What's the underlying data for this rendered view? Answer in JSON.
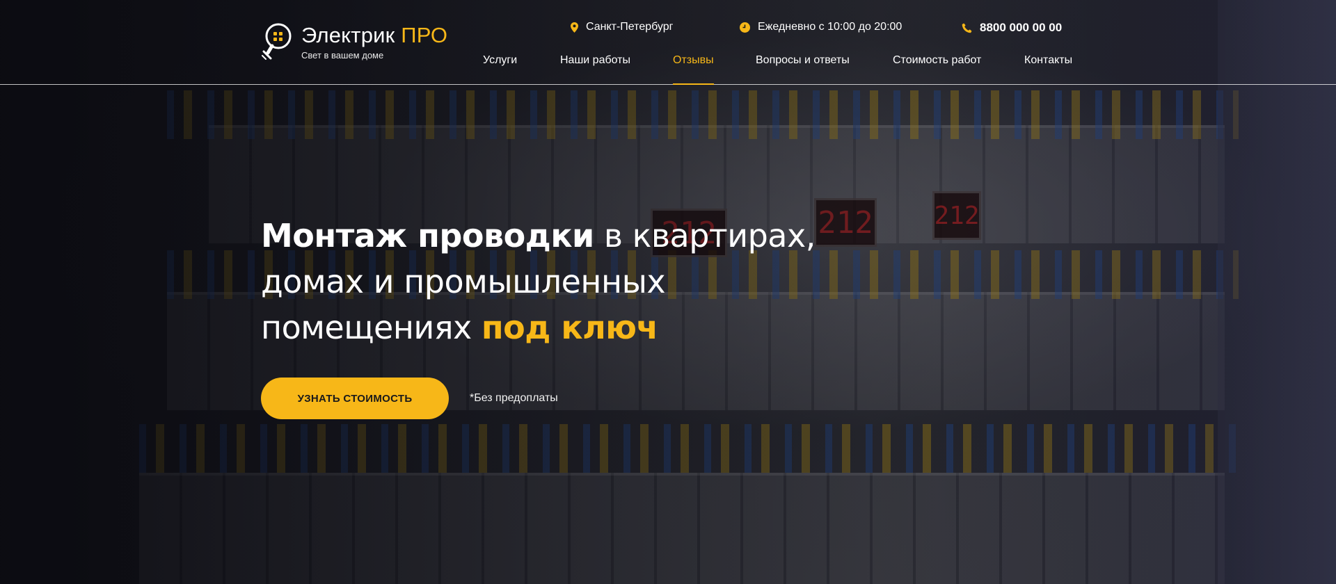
{
  "brand": {
    "name": "Электрик",
    "name_accent": "ПРО",
    "tagline": "Свет в вашем доме",
    "accent_color": "#f7b718"
  },
  "contacts": {
    "city": "Санкт-Петербург",
    "hours": "Ежедневно с 10:00 до 20:00",
    "phone": "8800 000 00 00"
  },
  "nav": {
    "items": [
      {
        "label": "Услуги"
      },
      {
        "label": "Наши работы"
      },
      {
        "label": "Отзывы",
        "active": true
      },
      {
        "label": "Вопросы и ответы"
      },
      {
        "label": "Стоимость работ"
      },
      {
        "label": "Контакты"
      }
    ]
  },
  "hero": {
    "title_strong": "Монтаж проводки",
    "title_line1_rest": " в квартирах,",
    "title_line2": "домах и промышленных",
    "title_line3": "помещениях ",
    "title_accent": "под ключ",
    "cta_label": "УЗНАТЬ СТОИМОСТЬ",
    "note": "*Без предоплаты"
  },
  "background": {
    "display_1": "212",
    "display_2": "212",
    "display_3": "212"
  }
}
